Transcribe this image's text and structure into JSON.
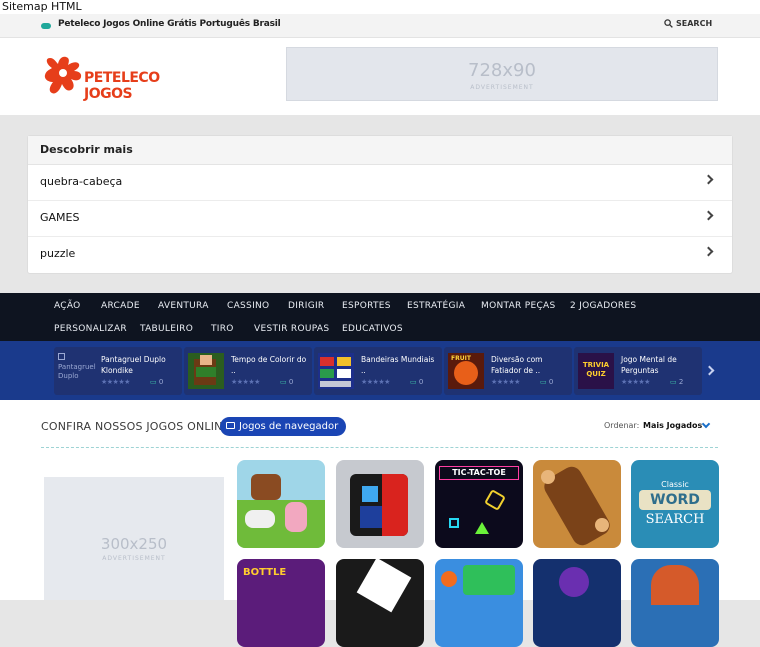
{
  "browser": {
    "sitemap_link": "Sitemap HTML"
  },
  "topbar": {
    "site_title": "Peteleco Jogos Online Grátis Português Brasil",
    "search_label": "SEARCH"
  },
  "header": {
    "logo_text": "PETELECO JOGOS",
    "ad_size": "728x90",
    "ad_label": "ADVERTISEMENT"
  },
  "discover": {
    "title": "Descobrir mais",
    "items": [
      "quebra-cabeça",
      "GAMES",
      "puzzle"
    ]
  },
  "nav": {
    "row1": [
      "AÇÃO",
      "ARCADE",
      "AVENTURA",
      "CASSINO",
      "DIRIGIR",
      "ESPORTES",
      "ESTRATÉGIA",
      "MONTAR PEÇAS",
      "2 JOGADORES"
    ],
    "row2": [
      "PERSONALIZAR",
      "TABULEIRO",
      "TIRO",
      "VESTIR ROUPAS",
      "EDUCATIVOS"
    ]
  },
  "featured": [
    {
      "title": "Pantagruel Duplo Klondike",
      "stars": "★★★★★",
      "plays": "0",
      "thumb_alt": "Pantagruel Duplo"
    },
    {
      "title": "Tempo de Colorir do ..",
      "stars": "★★★★★",
      "plays": "0"
    },
    {
      "title": "Bandeiras Mundiais ..",
      "stars": "★★★★★",
      "plays": "0"
    },
    {
      "title": "Diversão com Fatiador de ..",
      "stars": "★★★★★",
      "plays": "0"
    },
    {
      "title": "Jogo Mental de Perguntas",
      "stars": "★★★★★",
      "plays": "2"
    }
  ],
  "main": {
    "section_title": "CONFIRA NOSSOS JOGOS ONLINE",
    "badge": "Jogos de navegador",
    "sort_label": "Ordenar:",
    "sort_value": "Mais Jogados",
    "ad_size": "300x250",
    "ad_label": "ADVERTISEMENT"
  },
  "tile_texts": {
    "tictactoe": "TIC-TAC-TOE",
    "word": "WORD",
    "search": "SEARCH",
    "classic": "Classic",
    "bottle": "BOTTLE",
    "quiz": "TRIVIA QUIZ",
    "fruit": "FRUIT"
  },
  "colors": {
    "nav_bg": "#0e1420",
    "strip_bg": "#1a3a8c",
    "badge": "#1a45b4",
    "brand": "#e63e1a"
  }
}
